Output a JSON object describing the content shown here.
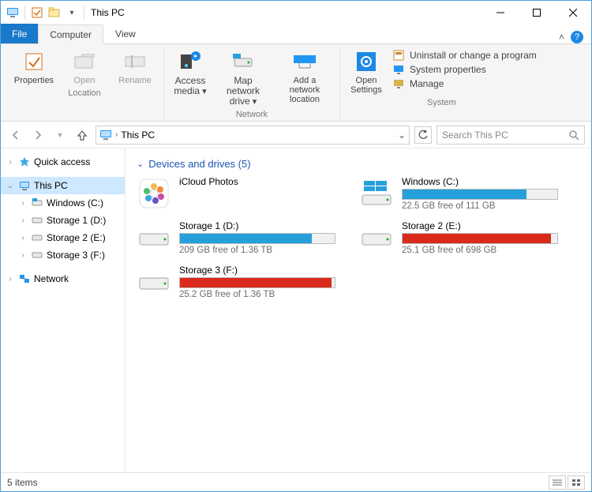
{
  "title": "This PC",
  "qat": {
    "dropdown": "▾"
  },
  "tabs": {
    "file": "File",
    "computer": "Computer",
    "view": "View"
  },
  "ribbon": {
    "location": {
      "properties": "Properties",
      "open": "Open",
      "rename": "Rename",
      "label": "Location"
    },
    "network": {
      "access_media": "Access media",
      "map_drive": "Map network drive",
      "add_location": "Add a network location",
      "label": "Network"
    },
    "system": {
      "open_settings": "Open Settings",
      "uninstall": "Uninstall or change a program",
      "sys_props": "System properties",
      "manage": "Manage",
      "label": "System"
    }
  },
  "breadcrumb": {
    "root": "This PC"
  },
  "search": {
    "placeholder": "Search This PC"
  },
  "nav": {
    "quick_access": "Quick access",
    "this_pc": "This PC",
    "windows_c": "Windows (C:)",
    "storage1": "Storage 1 (D:)",
    "storage2": "Storage 2 (E:)",
    "storage3": "Storage 3 (F:)",
    "network": "Network"
  },
  "group": {
    "header": "Devices and drives (5)"
  },
  "drives": [
    {
      "name": "iCloud Photos"
    },
    {
      "name": "Windows (C:)",
      "stat": "22.5 GB free of 111 GB",
      "fill_pct": 80,
      "color": "#26a0da"
    },
    {
      "name": "Storage 1 (D:)",
      "stat": "209 GB free of 1.36 TB",
      "fill_pct": 85,
      "color": "#26a0da"
    },
    {
      "name": "Storage 2 (E:)",
      "stat": "25.1 GB free of 698 GB",
      "fill_pct": 96,
      "color": "#d92a1c"
    },
    {
      "name": "Storage 3 (F:)",
      "stat": "25.2 GB free of 1.36 TB",
      "fill_pct": 98,
      "color": "#d92a1c"
    }
  ],
  "status": {
    "items": "5 items"
  }
}
